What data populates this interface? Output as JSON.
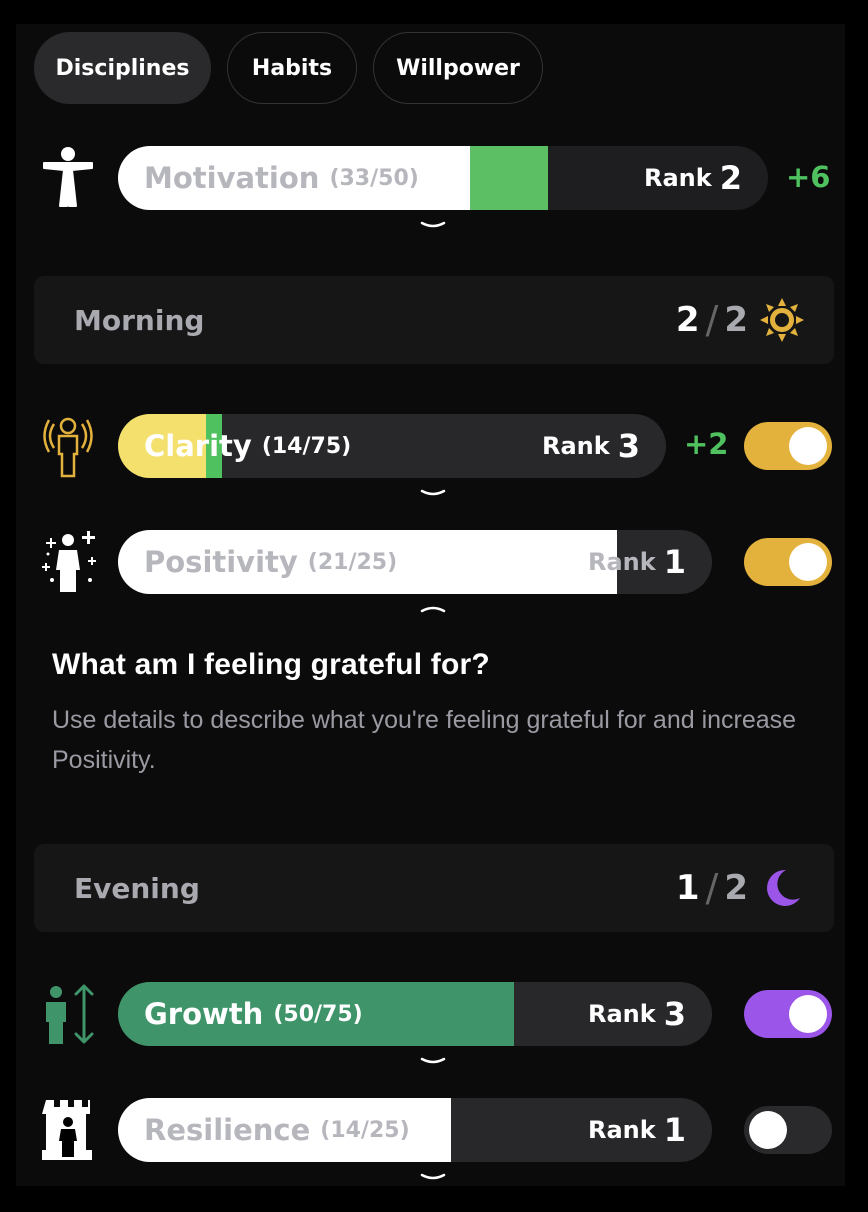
{
  "tabs": [
    {
      "label": "Disciplines",
      "active": true
    },
    {
      "label": "Habits",
      "active": false
    },
    {
      "label": "Willpower",
      "active": false
    }
  ],
  "motivation": {
    "name": "Motivation",
    "count": "(33/50)",
    "rank_label": "Rank",
    "rank": "2",
    "delta": "+6",
    "icon": "person-arms-out-icon",
    "progress": 0.66
  },
  "morning": {
    "title": "Morning",
    "done": "2",
    "total": "2",
    "icon": "sun-icon"
  },
  "clarity": {
    "name": "Clarity",
    "count": "(14/75)",
    "rank_label": "Rank",
    "rank": "3",
    "delta": "+2",
    "icon": "radiating-figure-icon",
    "toggle": "on",
    "progress": 0.187
  },
  "positivity": {
    "name": "Positivity",
    "count": "(21/25)",
    "rank_label": "Rank",
    "rank": "1",
    "icon": "sparkle-figure-icon",
    "toggle": "on",
    "progress": 0.84
  },
  "prompt": {
    "title": "What am I feeling grateful for?",
    "text": "Use details to describe what you're feeling grateful for and increase Positivity."
  },
  "evening": {
    "title": "Evening",
    "done": "1",
    "total": "2",
    "icon": "moon-icon"
  },
  "growth": {
    "name": "Growth",
    "count": "(50/75)",
    "rank_label": "Rank",
    "rank": "3",
    "icon": "growing-figure-icon",
    "toggle": "on",
    "progress": 0.667
  },
  "resilience": {
    "name": "Resilience",
    "count": "(14/25)",
    "rank_label": "Rank",
    "rank": "1",
    "icon": "tower-figure-icon",
    "toggle": "off",
    "progress": 0.56
  },
  "colors": {
    "toggle_yellow": "#e3b23c",
    "toggle_purple": "#9b55e8",
    "toggle_off": "#2a2a2c",
    "green": "#4fc25f",
    "growth_green": "#3f946a",
    "clarity_yellow": "#f4e06c"
  }
}
